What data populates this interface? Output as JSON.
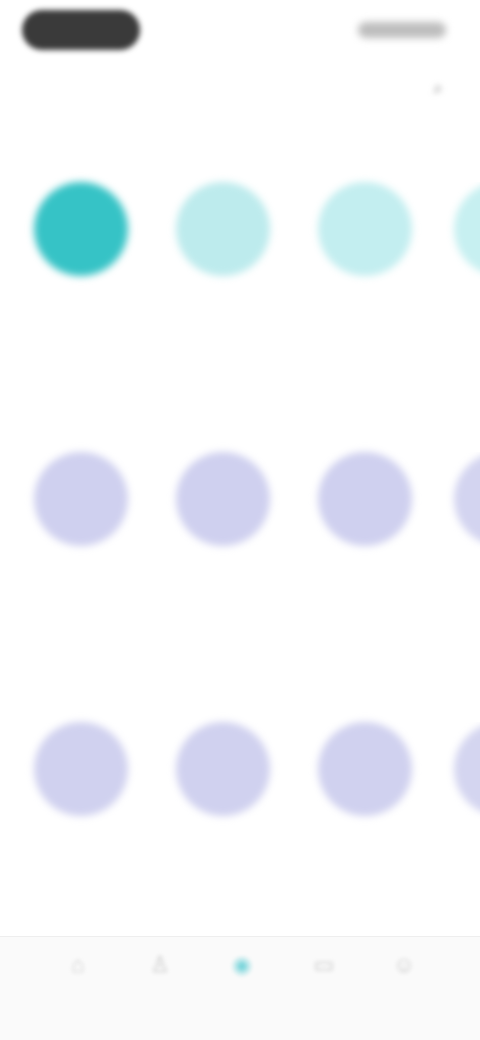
{
  "status_bar": {
    "time": "",
    "indicators": ""
  },
  "header": {
    "title": "",
    "action_icon": "search-icon"
  },
  "colors": {
    "featured_accent": "#2ec4c9",
    "featured_light": "#bfeef0",
    "lavender": "#cfd0ef",
    "nav_active": "#7fd6dc"
  },
  "sections": [
    {
      "title": "",
      "items": [
        {
          "label": "",
          "color": "#36c3c6"
        },
        {
          "label": "",
          "color": "#bdebed"
        },
        {
          "label": "",
          "color": "#c3eef0"
        },
        {
          "label": "",
          "color": "#c7f0f1"
        }
      ]
    },
    {
      "title": "",
      "items": [
        {
          "label": "",
          "color": "#cfd0ef"
        },
        {
          "label": "",
          "color": "#cfd0ef"
        },
        {
          "label": "",
          "color": "#cfd0ef"
        },
        {
          "label": "",
          "color": "#d3d4f0"
        }
      ]
    },
    {
      "title": "",
      "items": [
        {
          "label": "",
          "color": "#d0d1ef"
        },
        {
          "label": "",
          "color": "#d0d1ef"
        },
        {
          "label": "",
          "color": "#d0d1ef"
        },
        {
          "label": "",
          "color": "#d4d5f0"
        }
      ]
    }
  ],
  "bottom_nav": [
    {
      "icon": "home-icon",
      "label": "",
      "active": false
    },
    {
      "icon": "person-icon",
      "label": "",
      "active": false
    },
    {
      "icon": "compass-icon",
      "label": "",
      "active": true
    },
    {
      "icon": "chat-icon",
      "label": "",
      "active": false
    },
    {
      "icon": "profile-icon",
      "label": "",
      "active": false
    }
  ]
}
